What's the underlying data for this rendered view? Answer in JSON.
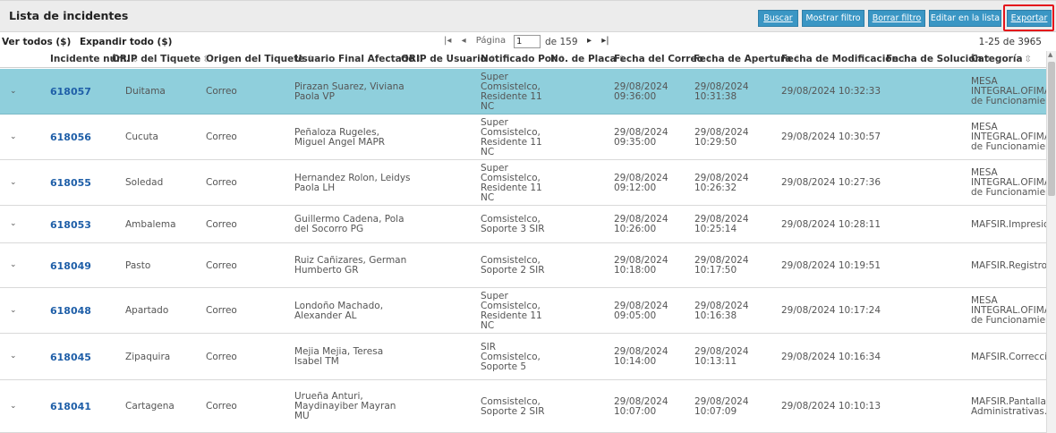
{
  "header": {
    "title": "Lista de incidentes",
    "buttons": {
      "buscar": "Buscar",
      "mostrar_filtro": "Mostrar filtro",
      "borrar_filtro": "Borrar filtro",
      "editar": "Editar en la lista",
      "exportar": "Exportar"
    }
  },
  "pager": {
    "ver_todos": "Ver todos ($)",
    "expandir": "Expandir todo ($)",
    "first_glyph": "|◂",
    "prev_glyph": "◂",
    "pagina_label": "Página",
    "page_value": "1",
    "of_label": "de 159",
    "next_glyph": "▸",
    "last_glyph": "▸|",
    "count": "1-25 de 3965"
  },
  "columns": [
    "Incidente núm.",
    "ORIP del Tiquete",
    "Origen del Tiquete",
    "Usuario Final Afectado",
    "ORIP de Usuario",
    "Notificado Por",
    "No. de Placa",
    "Fecha del Correo",
    "Fecha de Apertura",
    "Fecha de Modificacion",
    "Fecha de Solución",
    "Categoría"
  ],
  "sort_icons": {
    "neutral": "⇳",
    "desc": "⇩"
  },
  "rows": [
    {
      "selected": true,
      "id": "618057",
      "orip": "Duitama",
      "origen": "Correo",
      "usuario": [
        "Pirazan Suarez, Viviana",
        "Paola VP"
      ],
      "notificado": [
        "Super",
        "Comsistelco,",
        "Residente 11",
        "NC"
      ],
      "correo": [
        "29/08/2024",
        "09:36:00"
      ],
      "apertura": [
        "29/08/2024",
        "10:31:38"
      ],
      "modificacion": "29/08/2024 10:32:33",
      "categoria": [
        "MESA",
        "INTEGRAL.OFIMATI",
        "de Funcionamiento"
      ]
    },
    {
      "selected": false,
      "id": "618056",
      "orip": "Cucuta",
      "origen": "Correo",
      "usuario": [
        "Peñaloza Rugeles,",
        "Miguel Angel MAPR"
      ],
      "notificado": [
        "Super",
        "Comsistelco,",
        "Residente 11",
        "NC"
      ],
      "correo": [
        "29/08/2024",
        "09:35:00"
      ],
      "apertura": [
        "29/08/2024",
        "10:29:50"
      ],
      "modificacion": "29/08/2024 10:30:57",
      "categoria": [
        "MESA",
        "INTEGRAL.OFIMATI",
        "de Funcionamiento"
      ]
    },
    {
      "selected": false,
      "id": "618055",
      "orip": "Soledad",
      "origen": "Correo",
      "usuario": [
        "Hernandez Rolon, Leidys",
        "Paola LH"
      ],
      "notificado": [
        "Super",
        "Comsistelco,",
        "Residente 11",
        "NC"
      ],
      "correo": [
        "29/08/2024",
        "09:12:00"
      ],
      "apertura": [
        "29/08/2024",
        "10:26:32"
      ],
      "modificacion": "29/08/2024 10:27:36",
      "categoria": [
        "MESA",
        "INTEGRAL.OFIMATI",
        "de Funcionamiento"
      ]
    },
    {
      "selected": false,
      "id": "618053",
      "orip": "Ambalema",
      "origen": "Correo",
      "usuario": [
        "Guillermo Cadena, Pola",
        "del Socorro PG"
      ],
      "notificado": [
        "Comsistelco,",
        "Soporte 3 SIR"
      ],
      "correo": [
        "29/08/2024",
        "10:26:00"
      ],
      "apertura": [
        "29/08/2024",
        "10:25:14"
      ],
      "modificacion": "29/08/2024 10:28:11",
      "categoria": [
        "MAFSIR.Impresion"
      ]
    },
    {
      "selected": false,
      "id": "618049",
      "orip": "Pasto",
      "origen": "Correo",
      "usuario": [
        "Ruiz Cañizares, German",
        "Humberto GR"
      ],
      "notificado": [
        "Comsistelco,",
        "Soporte 2 SIR"
      ],
      "correo": [
        "29/08/2024",
        "10:18:00"
      ],
      "apertura": [
        "29/08/2024",
        "10:17:50"
      ],
      "modificacion": "29/08/2024 10:19:51",
      "categoria": [
        "MAFSIR.Registro d"
      ]
    },
    {
      "selected": false,
      "id": "618048",
      "orip": "Apartado",
      "origen": "Correo",
      "usuario": [
        "Londoño Machado,",
        "Alexander AL"
      ],
      "notificado": [
        "Super",
        "Comsistelco,",
        "Residente 11",
        "NC"
      ],
      "correo": [
        "29/08/2024",
        "09:05:00"
      ],
      "apertura": [
        "29/08/2024",
        "10:16:38"
      ],
      "modificacion": "29/08/2024 10:17:24",
      "categoria": [
        "MESA",
        "INTEGRAL.OFIMATI",
        "de Funcionamiento"
      ]
    },
    {
      "selected": false,
      "id": "618045",
      "orip": "Zipaquira",
      "origen": "Correo",
      "usuario": [
        "Mejia Mejia, Teresa",
        "Isabel TM"
      ],
      "notificado": [
        "SIR",
        "Comsistelco,",
        "Soporte 5"
      ],
      "correo": [
        "29/08/2024",
        "10:14:00"
      ],
      "apertura": [
        "29/08/2024",
        "10:13:11"
      ],
      "modificacion": "29/08/2024 10:16:34",
      "categoria": [
        "MAFSIR.Correccion"
      ]
    },
    {
      "selected": false,
      "id": "618041",
      "orip": "Cartagena",
      "origen": "Correo",
      "usuario": [
        "Urueña Anturi,",
        "Maydinayiber Mayran",
        "MU"
      ],
      "notificado": [
        "Comsistelco,",
        "Soporte 2 SIR"
      ],
      "correo": [
        "29/08/2024",
        "10:07:00"
      ],
      "apertura": [
        "29/08/2024",
        "10:07:09"
      ],
      "modificacion": "29/08/2024 10:10:13",
      "categoria": [
        "MAFSIR.Pantallas",
        "Administrativas.Re"
      ]
    }
  ],
  "icons": {
    "row_expand": "chevron-down-icon",
    "sort": "sort-arrows-icon"
  }
}
